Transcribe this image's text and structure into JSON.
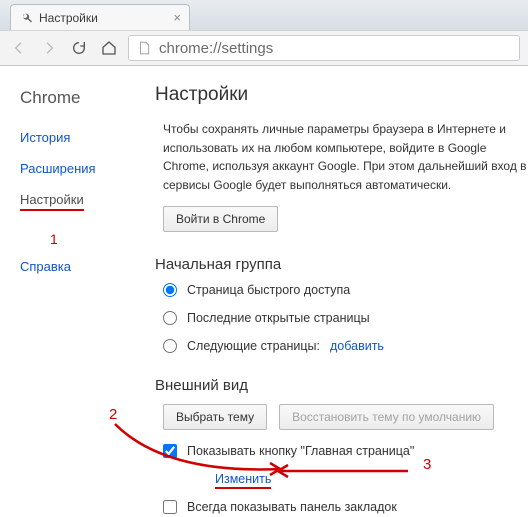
{
  "tab": {
    "title": "Настройки"
  },
  "omnibox": {
    "url": "chrome://settings"
  },
  "sidebar": {
    "brand": "Chrome",
    "items": [
      "История",
      "Расширения",
      "Настройки",
      "Справка"
    ],
    "active_index": 2,
    "annotation_1": "1"
  },
  "content": {
    "heading": "Настройки",
    "sync_desc": "Чтобы сохранять личные параметры браузера в Интернете и использовать их на любом компьютере, войдите в Google Chrome, используя аккаунт Google. При этом дальнейший вход в сервисы Google будет выполняться автоматически.",
    "sync_button": "Войти в Chrome",
    "startup": {
      "title": "Начальная группа",
      "opt1": "Страница быстрого доступа",
      "opt2": "Последние открытые страницы",
      "opt3_prefix": "Следующие страницы:",
      "opt3_link": "добавить"
    },
    "appearance": {
      "title": "Внешний вид",
      "choose_theme": "Выбрать тему",
      "reset_theme": "Восстановить тему по умолчанию",
      "show_home_label": "Показывать кнопку \"Главная страница\"",
      "change_link": "Изменить",
      "show_bookmarks": "Всегда показывать панель закладок"
    },
    "annotation_2": "2",
    "annotation_3": "3"
  }
}
